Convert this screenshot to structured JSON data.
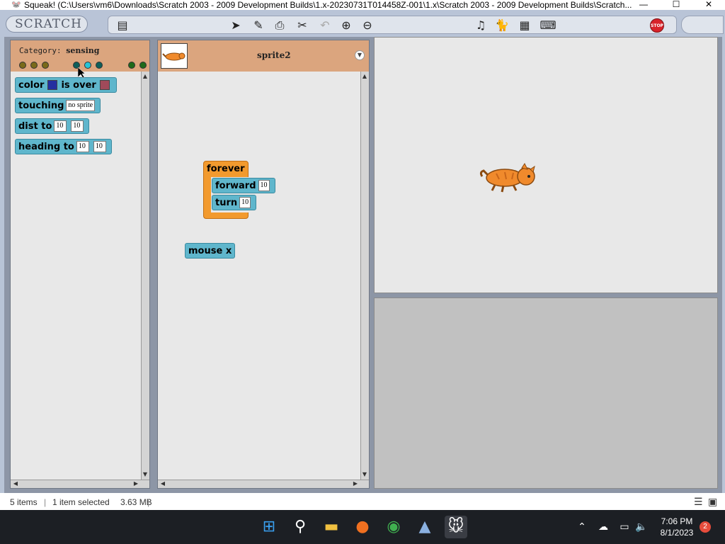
{
  "window": {
    "title": "Squeak! (C:\\Users\\vm6\\Downloads\\Scratch 2003 - 2009 Development Builds\\1.x-20230731T014458Z-001\\1.x\\Scratch 2003 - 2009 Development Builds\\Scratch...",
    "minimize": "—",
    "maximize": "☐",
    "close": "✕"
  },
  "menubar": {
    "logo": "SCRATCH",
    "stop_label": "STOP"
  },
  "palette": {
    "category_prefix": "Category:",
    "category_name": "sensing",
    "blocks": [
      {
        "label": "color",
        "middle": "is over"
      },
      {
        "label": "touching",
        "slot": "no sprite"
      },
      {
        "label": "dist to",
        "slot1": "10",
        "slot2": "10"
      },
      {
        "label": "heading to",
        "slot1": "10",
        "slot2": "10"
      }
    ]
  },
  "scripts": {
    "sprite_name": "sprite2",
    "forever_label": "forever",
    "forward_label": "forward",
    "forward_value": "10",
    "turn_label": "turn",
    "turn_value": "10",
    "mouse_label": "mouse x"
  },
  "status": {
    "items": "5 items",
    "selected": "1 item selected",
    "size": "3.63 MB"
  },
  "taskbar": {
    "time": "7:06 PM",
    "date": "8/1/2023",
    "notifications": "2"
  },
  "colors": {
    "sensing_block": "#5fb6cc",
    "control_block": "#f29a2e",
    "header": "#dba57e",
    "color_swatch_1": "#2430a0",
    "color_swatch_2": "#a04a5a"
  }
}
